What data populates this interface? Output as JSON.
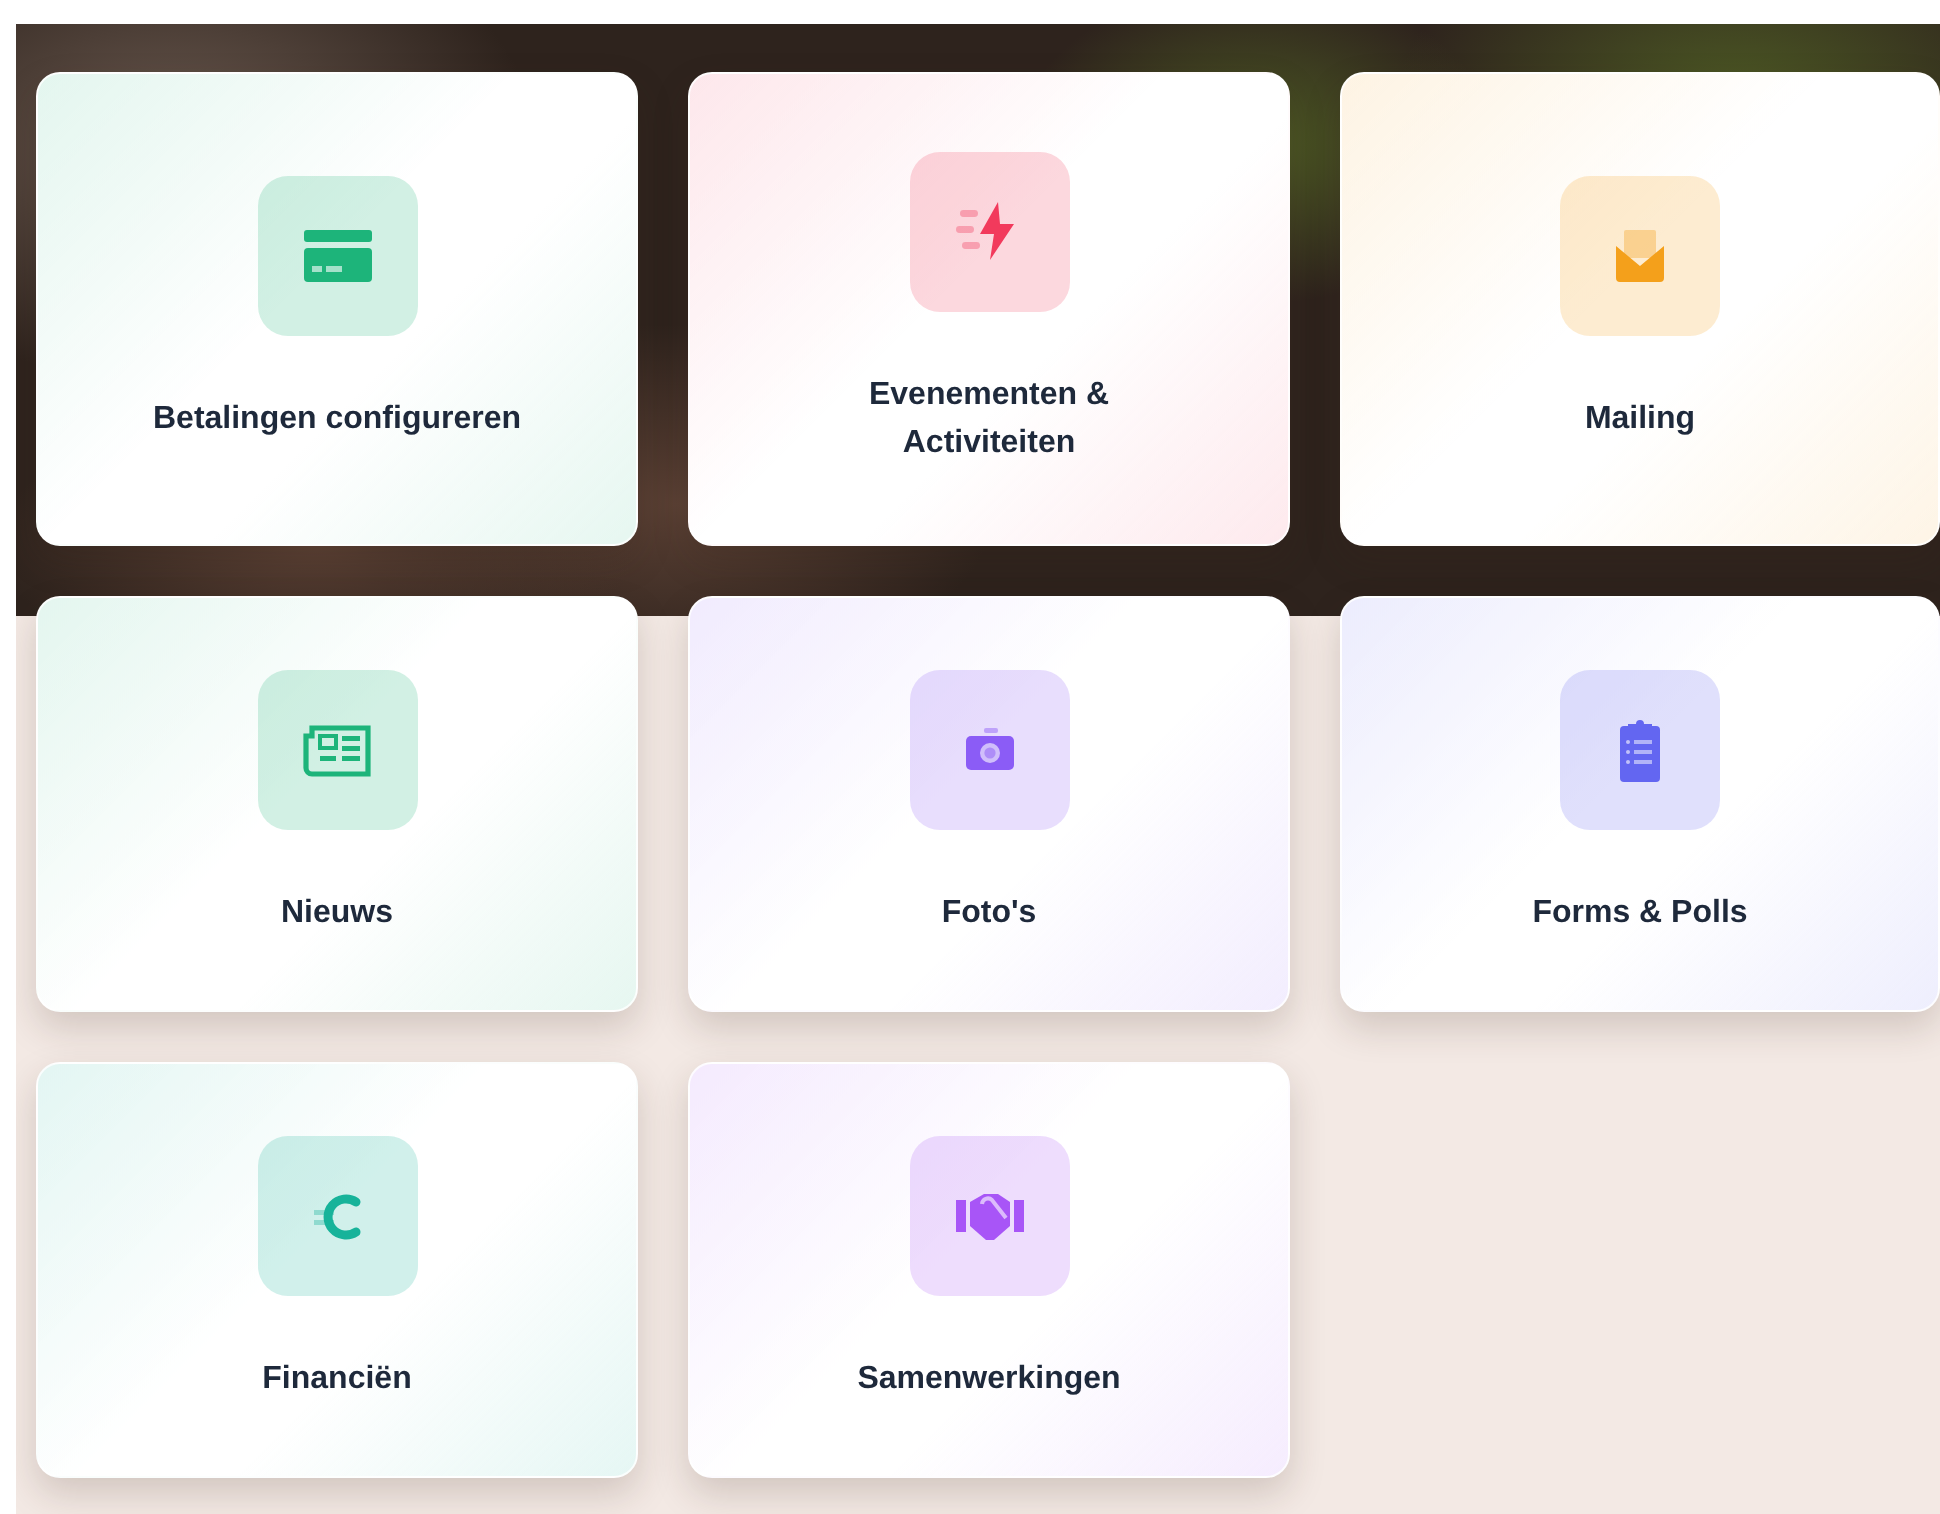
{
  "tiles": [
    {
      "label": "Betalingen configureren",
      "color": "#1db47a"
    },
    {
      "label": "Evenementen & Activiteiten",
      "color": "#f23a5c"
    },
    {
      "label": "Mailing",
      "color": "#f4a01b"
    },
    {
      "label": "Nieuws",
      "color": "#1db47a"
    },
    {
      "label": "Foto's",
      "color": "#8b5cf6"
    },
    {
      "label": "Forms & Polls",
      "color": "#6366f1"
    },
    {
      "label": "Financiën",
      "color": "#17b39a"
    },
    {
      "label": "Samenwerkingen",
      "color": "#a855f7"
    }
  ]
}
